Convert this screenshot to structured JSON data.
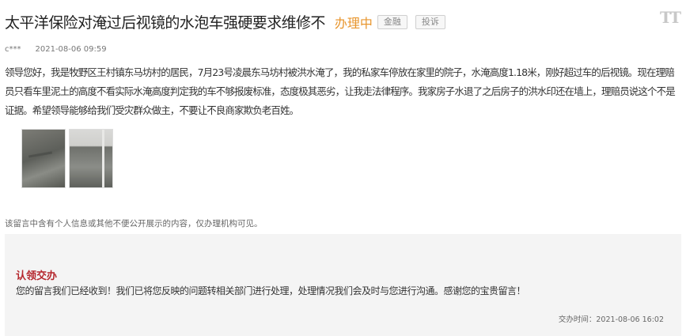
{
  "header": {
    "title": "太平洋保险对淹过后视镜的水泡车强硬要求维修不",
    "status": "办理中",
    "tag_category": "金融",
    "tag_type": "投诉"
  },
  "font_toggle_label": "TT",
  "meta": {
    "author": "c***",
    "timestamp": "2021-08-06 09:59"
  },
  "message": {
    "content": "领导您好，我是牧野区王村镇东马坊村的居民，7月23号凌晨东马坊村被洪水淹了，我的私家车停放在家里的院子，水淹高度1.18米，刚好超过车的后视镜。现在理赔员只看车里泥土的高度不看实际水淹高度判定我的车不够报废标准，态度极其恶劣，让我走法律程序。我家房子水退了之后房子的洪水印还在墙上，理赔员说这个不是证据。希望领导能够给我们受灾群众做主，不要让不良商家欺负老百姓。"
  },
  "privacy_note": "该留言中含有个人信息或其他不便公开展示的内容，仅办理机构可见。",
  "reply": {
    "title": "认领交办",
    "text": "您的留言我们已经收到！我们已将您反映的问题转相关部门进行处理，处理情况我们会及时与您进行沟通。感谢您的宝贵留言！",
    "time": "交办时间：2021-08-06 16:02"
  },
  "colors": {
    "status": "#e8962e",
    "reply_title": "#b5272d",
    "reply_bg": "#f4f4f4"
  }
}
